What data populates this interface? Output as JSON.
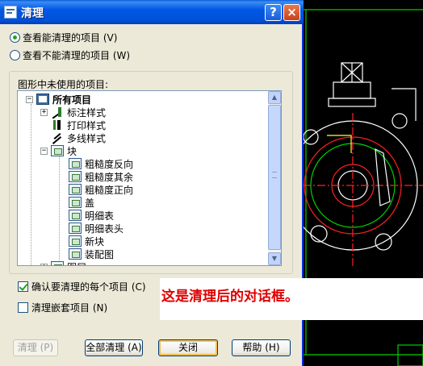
{
  "window": {
    "title": "清理"
  },
  "titlebar": {
    "help_glyph": "?",
    "close_glyph": "×"
  },
  "view_options": [
    {
      "label": "查看能清理的项目 (V)",
      "selected": true
    },
    {
      "label": "查看不能清理的项目 (W)",
      "selected": false
    }
  ],
  "group": {
    "label": "图形中未使用的项目:"
  },
  "tree": {
    "root": {
      "expander": "−",
      "label": "所有项目"
    },
    "items": [
      {
        "expander": "+",
        "label": "标注样式",
        "icon": "dimension-style-icon"
      },
      {
        "expander": "",
        "label": "打印样式",
        "icon": "plot-style-icon"
      },
      {
        "expander": "",
        "label": "多线样式",
        "icon": "multiline-style-icon"
      },
      {
        "expander": "−",
        "label": "块",
        "icon": "block-icon"
      },
      {
        "expander": "",
        "label": "粗糙度反向",
        "icon": "block-icon"
      },
      {
        "expander": "",
        "label": "粗糙度其余",
        "icon": "block-icon"
      },
      {
        "expander": "",
        "label": "粗糙度正向",
        "icon": "block-icon"
      },
      {
        "expander": "",
        "label": "盖",
        "icon": "block-icon"
      },
      {
        "expander": "",
        "label": "明细表",
        "icon": "block-icon"
      },
      {
        "expander": "",
        "label": "明细表头",
        "icon": "block-icon"
      },
      {
        "expander": "",
        "label": "新块",
        "icon": "block-icon"
      },
      {
        "expander": "",
        "label": "装配图",
        "icon": "block-icon"
      },
      {
        "expander": "+",
        "label": "图层",
        "icon": "layer-icon"
      }
    ]
  },
  "checkboxes": [
    {
      "label": "确认要清理的每个项目 (C)",
      "checked": true
    },
    {
      "label": "清理嵌套项目 (N)",
      "checked": false
    }
  ],
  "annotation": {
    "text": "这是清理后的对话框。"
  },
  "buttons": {
    "purge": "清理 (P)",
    "purge_all": "全部清理 (A)",
    "close": "关闭",
    "help": "帮助 (H)"
  },
  "colors": {
    "titlebar": "#0058e6",
    "dialog_bg": "#ece9d8",
    "annotation_text": "#e00000",
    "cad_bg": "#000000"
  }
}
